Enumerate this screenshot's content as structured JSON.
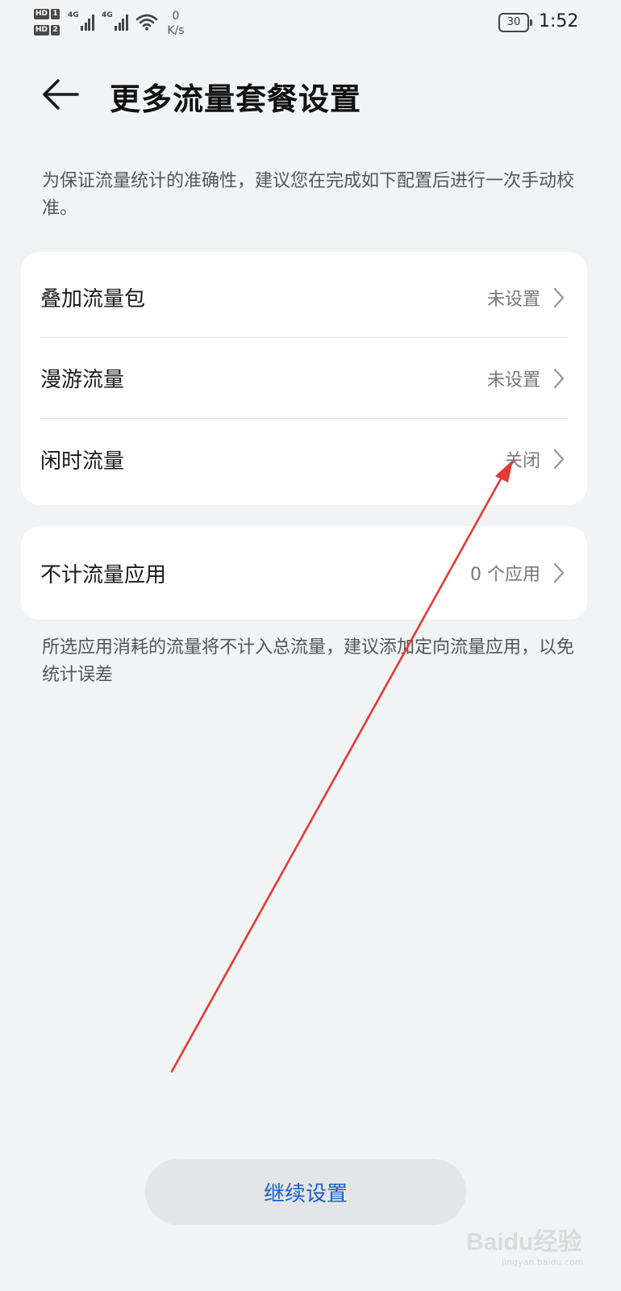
{
  "status_bar": {
    "sim1_hd": "HD",
    "sim1_slot": "1",
    "sim2_hd": "HD",
    "sim2_slot": "2",
    "network1": "4G",
    "network2": "4G",
    "speed_value": "0",
    "speed_unit": "K/s",
    "battery": "30",
    "time": "1:52"
  },
  "header": {
    "back_icon": "arrow-left-icon",
    "title": "更多流量套餐设置"
  },
  "intro_note": "为保证流量统计的准确性，建议您在完成如下配置后进行一次手动校准。",
  "settings_group_1": [
    {
      "label": "叠加流量包",
      "value": "未设置"
    },
    {
      "label": "漫游流量",
      "value": "未设置"
    },
    {
      "label": "闲时流量",
      "value": "关闭"
    }
  ],
  "settings_group_2": [
    {
      "label": "不计流量应用",
      "value": "0 个应用"
    }
  ],
  "footer_note": "所选应用消耗的流量将不计入总流量，建议添加定向流量应用，以免统计误差",
  "continue_button": "继续设置",
  "watermark": {
    "main": "Baidu经验",
    "sub": "jingyan.baidu.com"
  },
  "colors": {
    "background": "#f1f3f5",
    "card": "#ffffff",
    "accent_blue": "#1a5fd0",
    "annotation_red": "#e53935"
  }
}
